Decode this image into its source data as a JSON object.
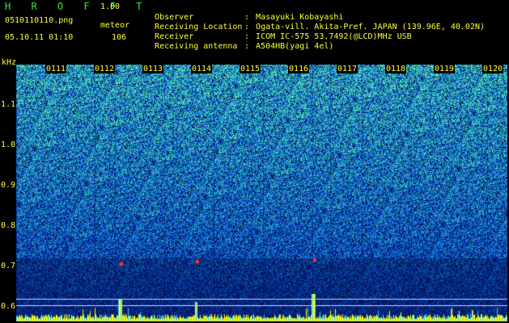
{
  "header": {
    "app_name": "H R O F F T",
    "app_version": "1.00",
    "file_name": "0510110110.png",
    "meteor_label": "meteor",
    "datetime": "05.10.11 01:10",
    "meteor_count": "106"
  },
  "info": [
    {
      "key": "Observer",
      "value": "Masayuki Kobayashi"
    },
    {
      "key": "Receiving Location",
      "value": "Ogata-vill. Akita-Pref. JAPAN (139.96E, 40.02N)"
    },
    {
      "key": "Receiver",
      "value": "ICOM IC-575 53.7492(@LCD)MHz USB"
    },
    {
      "key": "Receiving antenna",
      "value": "A504HB(yagi 4el)"
    }
  ],
  "spectrogram": {
    "y_unit": "kHz",
    "y_ticks": [
      "1.1",
      "1.0",
      "0.9",
      "0.8",
      "0.7",
      "0.6"
    ],
    "x_ticks": [
      "0111",
      "0112",
      "0113",
      "0114",
      "0115",
      "0116",
      "0117",
      "0118",
      "0119",
      "0120"
    ],
    "colors": {
      "background": "#000000",
      "low": "#0a1a8c",
      "mid": "#1e6be0",
      "high": "#38d0c0",
      "hot": "#ff3030",
      "bar": "#ffff00"
    }
  }
}
